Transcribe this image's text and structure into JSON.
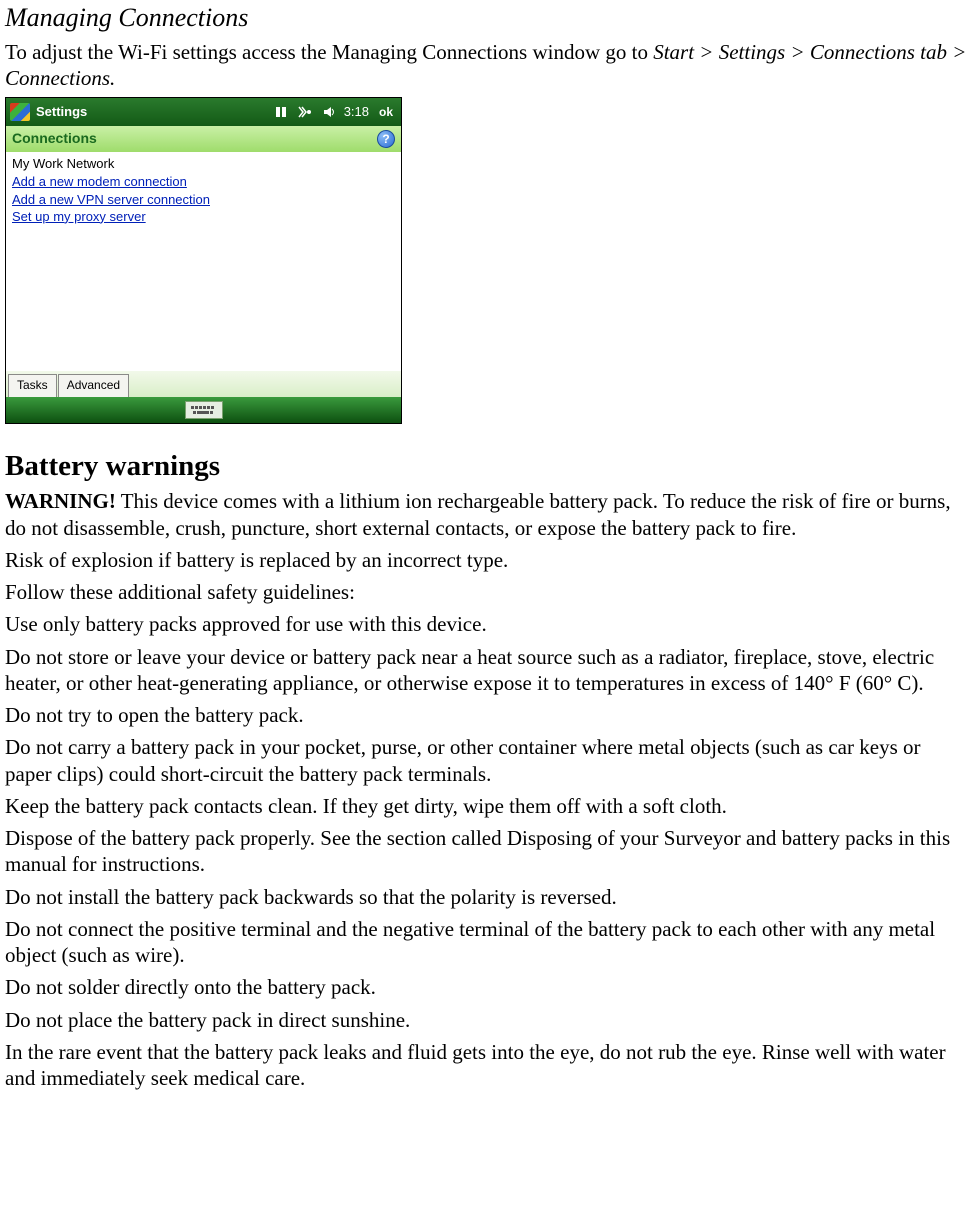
{
  "section1": {
    "heading": "Managing Connections",
    "intro_plain1": "To adjust the Wi-Fi settings access the Managing Connections window go to ",
    "intro_italic": "Start > Settings > Connections tab > Connections.",
    "screenshot": {
      "topbar": {
        "title": "Settings",
        "clock": "3:18",
        "ok": "ok"
      },
      "conn_header": "Connections",
      "help_glyph": "?",
      "network_label": "My Work Network",
      "links": [
        "Add a new modem connection",
        "Add a new VPN server connection",
        "Set up my proxy server"
      ],
      "tabs": [
        "Tasks",
        "Advanced"
      ]
    }
  },
  "section2": {
    "heading": "Battery warnings",
    "warn_label": "WARNING!",
    "warn_text": " This device comes with a lithium ion rechargeable battery pack. To reduce the risk of fire or burns, do not disassemble, crush, puncture, short external contacts, or expose the battery pack to fire.",
    "paras": [
      "Risk of explosion if battery is replaced by an incorrect type.",
      "Follow these additional safety guidelines:",
      "Use only battery packs approved for use with this device.",
      "Do not store or leave your device or battery pack near a heat source such as a radiator, fireplace, stove, electric heater, or other heat-generating appliance, or otherwise expose it to temperatures in excess of 140° F (60° C).",
      "Do not try to open the battery pack.",
      "Do not carry a battery pack in your pocket, purse, or other container where metal objects (such as car keys or paper clips) could short-circuit the battery pack terminals.",
      "Keep the battery pack contacts clean. If they get dirty, wipe them off with a soft cloth.",
      "Dispose of the battery pack properly. See the section called Disposing of your Surveyor and battery packs in this manual for instructions.",
      "Do not install the battery pack backwards so that the polarity is reversed.",
      "Do not connect the positive terminal and the negative terminal of the battery pack to each other with any metal object (such as wire).",
      "Do not solder directly onto the battery pack.",
      "Do not place the battery pack in direct sunshine.",
      "In the rare event that the battery pack leaks and fluid gets into the eye, do not rub the eye. Rinse well with water and immediately seek medical care."
    ]
  }
}
